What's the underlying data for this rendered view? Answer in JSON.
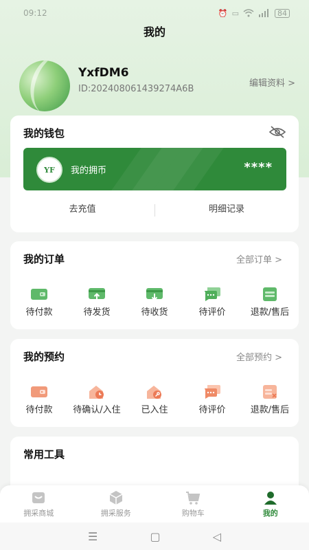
{
  "status_bar": {
    "time": "09:12",
    "battery": "84"
  },
  "page": {
    "title": "我的"
  },
  "profile": {
    "name": "YxfDM6",
    "id_text": "ID:20240806143927​4A6B",
    "edit_label": "编辑资料 >"
  },
  "wallet": {
    "title": "我的钱包",
    "coin_label": "我的拥币",
    "coin_amount": "****",
    "recharge_label": "去充值",
    "details_label": "明细记录",
    "accent_color": "#2f8a3a"
  },
  "orders": {
    "title": "我的订单",
    "link_label": "全部订单 >",
    "items": [
      {
        "label": "待付款",
        "icon": "wallet-icon"
      },
      {
        "label": "待发货",
        "icon": "ship-icon"
      },
      {
        "label": "待收货",
        "icon": "receive-icon"
      },
      {
        "label": "待评价",
        "icon": "comment-icon"
      },
      {
        "label": "退款/售后",
        "icon": "refund-icon"
      }
    ]
  },
  "reservations": {
    "title": "我的预约",
    "link_label": "全部预约 >",
    "items": [
      {
        "label": "待付款",
        "icon": "wallet-icon"
      },
      {
        "label": "待确认/入住",
        "icon": "house-clock-icon"
      },
      {
        "label": "已入住",
        "icon": "house-key-icon"
      },
      {
        "label": "待评价",
        "icon": "comment-icon"
      },
      {
        "label": "退款/售后",
        "icon": "refund-icon"
      }
    ]
  },
  "tools": {
    "title": "常用工具"
  },
  "bottom_nav": {
    "items": [
      {
        "label": "拥采商城",
        "icon": "store-icon"
      },
      {
        "label": "拥采服务",
        "icon": "box-icon"
      },
      {
        "label": "购物车",
        "icon": "cart-icon"
      },
      {
        "label": "我的",
        "icon": "user-icon",
        "active": true
      }
    ]
  }
}
